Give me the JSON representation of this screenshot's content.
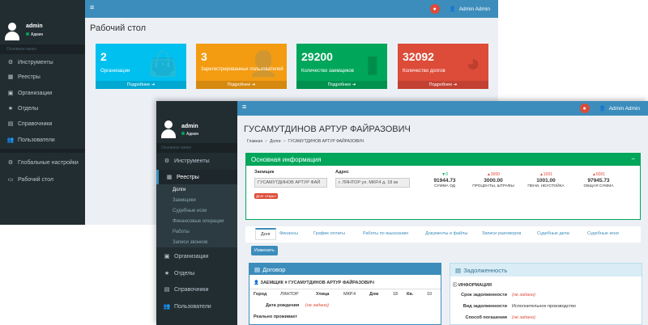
{
  "back_window": {
    "user": {
      "name": "admin",
      "status": "Админ"
    },
    "menu_header": "Основное меню",
    "menu": [
      {
        "icon": "cogs-icon",
        "glyph": "⚙",
        "label": "Инструменты"
      },
      {
        "icon": "table-icon",
        "glyph": "▦",
        "label": "Реестры"
      },
      {
        "icon": "building-icon",
        "glyph": "▣",
        "label": "Организации"
      },
      {
        "icon": "star-icon",
        "glyph": "★",
        "label": "Отделы"
      },
      {
        "icon": "book-icon",
        "glyph": "▤",
        "label": "Справочники"
      },
      {
        "icon": "users-icon",
        "glyph": "👥",
        "label": "Пользователи"
      },
      {
        "icon": "globe-icon",
        "glyph": "⚙",
        "label": "Глобальные настройки"
      },
      {
        "icon": "desktop-icon",
        "glyph": "▭",
        "label": "Рабочий стол"
      }
    ],
    "topbar": {
      "user": "Admin Admin"
    },
    "page_title": "Рабочий стол",
    "tiles": [
      {
        "value": "2",
        "label": "Организации",
        "footer": "Подробнее ➔",
        "color": "#00c0ef",
        "icon": "bag-icon",
        "glyph": "👜"
      },
      {
        "value": "3",
        "label": "Зарегистрированных пользователей",
        "footer": "Подробнее ➔",
        "color": "#f39c12",
        "icon": "user-plus-icon",
        "glyph": "👤"
      },
      {
        "value": "29200",
        "label": "Количество заемщиков",
        "footer": "Подробнее ➔",
        "color": "#00a65a",
        "icon": "bar-chart-icon",
        "glyph": "▮"
      },
      {
        "value": "32092",
        "label": "Количество долгов",
        "footer": "Подробнее ➔",
        "color": "#dd4b39",
        "icon": "pie-chart-icon",
        "glyph": "◕"
      }
    ]
  },
  "front_window": {
    "user": {
      "name": "admin",
      "status": "Админ"
    },
    "menu_header": "Основное меню",
    "menu": [
      {
        "icon": "cogs-icon",
        "glyph": "⚙",
        "label": "Инструменты"
      },
      {
        "icon": "table-icon",
        "glyph": "▦",
        "label": "Реестры"
      }
    ],
    "submenu": [
      "Долги",
      "Заемщики",
      "Судебные иски",
      "Финансовые операции",
      "Работы",
      "Записи звонков"
    ],
    "menu_after": [
      {
        "icon": "building-icon",
        "glyph": "▣",
        "label": "Организации"
      },
      {
        "icon": "star-icon",
        "glyph": "★",
        "label": "Отделы"
      },
      {
        "icon": "book-icon",
        "glyph": "▤",
        "label": "Справочники"
      },
      {
        "icon": "users-icon",
        "glyph": "👥",
        "label": "Пользователи"
      }
    ],
    "topbar": {
      "user": "Admin Admin"
    },
    "title": "ГУСАМУТДИНОВ АРТУР ФАЙРАЗОВИЧ",
    "breadcrumb": [
      "Главная",
      "Долги",
      "ГУСАМУТДИНОВ АРТУР ФАЙРАЗОВИЧ"
    ],
    "main_box": {
      "title": "Основная информация",
      "borrower_label": "Заемщик",
      "borrower_value": "ГУСАМУТДИНОВ АРТУР ФАЙ",
      "address_label": "Адрес",
      "address_value": "г. ЛЯНТОР ул. МКР.4 д. 18 кв",
      "debt_badge": "Долг открыт",
      "stats": [
        {
          "delta": "▼0",
          "dir": "dn",
          "value": "91944.73",
          "caption": "СУММА ОД"
        },
        {
          "delta": "▲3000",
          "dir": "up",
          "value": "3000.00",
          "caption": "ПРОЦЕНТЫ, ШТРАФЫ"
        },
        {
          "delta": "▲1001",
          "dir": "up",
          "value": "1001.00",
          "caption": "ПЕНИ, НЕУСТОЙКА"
        },
        {
          "delta": "▲6001",
          "dir": "up",
          "value": "97945.73",
          "caption": "ОБЩАЯ СУММА"
        }
      ]
    },
    "tabs": [
      "Долг",
      "Финансы",
      "График оплаты",
      "Работы по взысканию",
      "Документы и файлы",
      "Записи разговоров",
      "Судебные дела",
      "Судебные иски"
    ],
    "edit_button": "Изменить",
    "contract_panel": {
      "title": "Договор",
      "subtitle": "ЗАЕМЩИК # ГУСАМУТДИНОВ АРТУР ФАЙРАЗОВИЧ",
      "city_label": "Город",
      "city": "ЛЯНТОР",
      "street_label": "Улица",
      "street": "МКР.4",
      "house_label": "Дом",
      "house": "18",
      "apt_label": "Кв.",
      "apt": "10",
      "dob_label": "Дата рождения",
      "dob": "(не задано)",
      "lives_label": "Реально проживает"
    },
    "debt_panel": {
      "title": "Задолженность",
      "subtitle": "ИНФОРМАЦИЯ",
      "rows": [
        {
          "label": "Срок задолженности",
          "value": "(не задано)",
          "not_set": true
        },
        {
          "label": "Вид задолженности",
          "value": "Исполнительное производство",
          "not_set": false
        },
        {
          "label": "Способ погашения",
          "value": "(не задано)",
          "not_set": true
        }
      ]
    }
  }
}
